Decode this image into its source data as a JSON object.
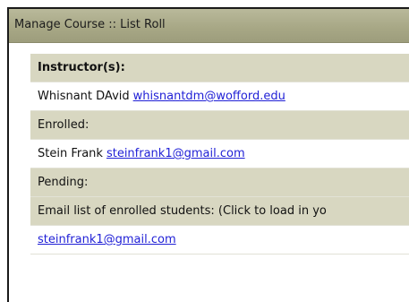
{
  "title_bar": {
    "text": "Manage Course :: List Roll"
  },
  "roll": {
    "instructors_heading": "Instructor(s):",
    "instructor": {
      "name": "Whisnant DAvid",
      "email": "whisnantdm@wofford.edu"
    },
    "enrolled_heading": "Enrolled:",
    "enrolled_student": {
      "name": "Stein Frank",
      "email": "steinfrank1@gmail.com"
    },
    "pending_heading": "Pending:",
    "email_list_heading": "Email list of enrolled students: (Click to load in yo",
    "email_list_link": "steinfrank1@gmail.com"
  },
  "colors": {
    "title_bar": "#a8a886",
    "header_row": "#d8d7c1",
    "link": "#1f1fd6"
  }
}
